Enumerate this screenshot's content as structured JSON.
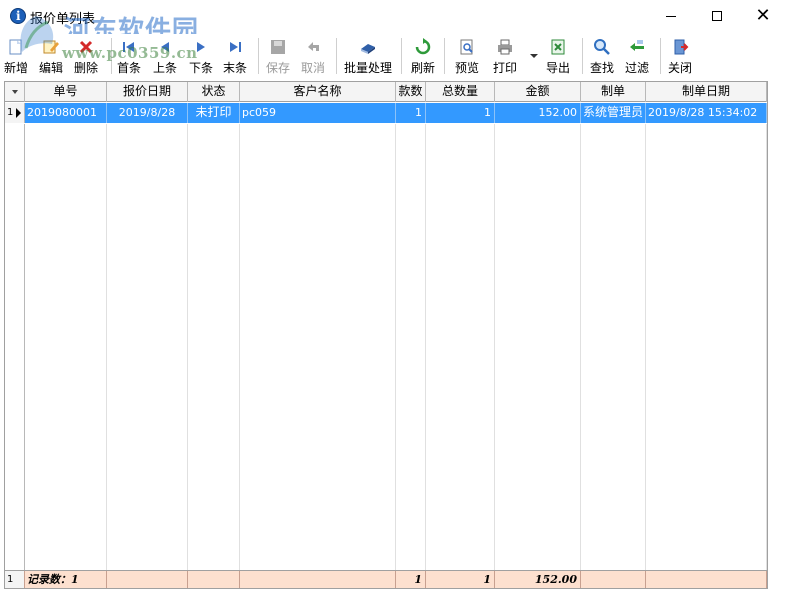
{
  "window": {
    "title": "报价单列表",
    "watermark": "河东软件园",
    "watermark_url": "www.pc0359.cn"
  },
  "toolbar": {
    "new": "新增",
    "edit": "编辑",
    "delete": "删除",
    "first": "首条",
    "prev": "上条",
    "next": "下条",
    "last": "末条",
    "save": "保存",
    "cancel": "取消",
    "batch": "批量处理",
    "refresh": "刷新",
    "preview": "预览",
    "print": "打印",
    "export": "导出",
    "find": "查找",
    "filter": "过滤",
    "close": "关闭"
  },
  "table": {
    "columns": [
      "单号",
      "报价日期",
      "状态",
      "客户名称",
      "款数",
      "总数量",
      "金额",
      "制单",
      "制单日期"
    ],
    "rows": [
      {
        "index": "1",
        "order_no": "2019080001",
        "quote_date": "2019/8/28",
        "status": "未打印",
        "customer": "pc059",
        "styles": "1",
        "total_qty": "1",
        "amount": "152.00",
        "creator": "系统管理员",
        "created_at": "2019/8/28 15:34:02"
      }
    ],
    "footer": {
      "index": "1",
      "record_count": "记录数：1",
      "styles": "1",
      "total_qty": "1",
      "amount": "152.00"
    }
  },
  "colors": {
    "selection": "#3399ff",
    "footer_bg": "#fde0cf"
  }
}
